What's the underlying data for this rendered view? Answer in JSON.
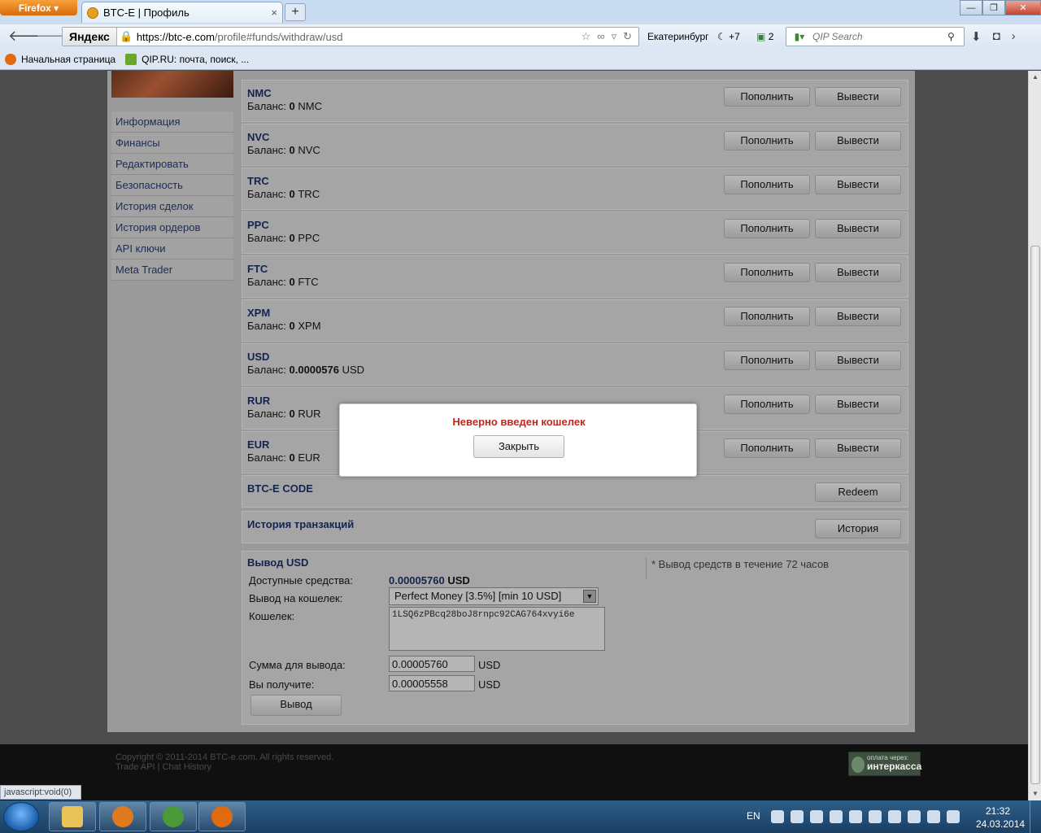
{
  "browser": {
    "menu_button": "Firefox",
    "tab_title": "BTC-E | Профиль",
    "tab_close": "×",
    "new_tab": "+",
    "url": {
      "scheme_host_prefix": "https://btc-e.com",
      "path": "/profile#funds/withdraw/usd"
    },
    "yandex_badge": "Яндекс",
    "weather_city": "Екатеринбург",
    "weather_temp": "+7",
    "mail_count": "2",
    "search_placeholder": "QIP Search",
    "window_buttons": [
      "—",
      "❐",
      "✕"
    ]
  },
  "bookmarks": [
    {
      "label": "Начальная страница"
    },
    {
      "label": "QIP.RU: почта, поиск, ..."
    }
  ],
  "sidebar": {
    "items": [
      "Информация",
      "Финансы",
      "Редактировать",
      "Безопасность",
      "История сделок",
      "История ордеров",
      "API ключи",
      "Meta Trader"
    ]
  },
  "balance_label": "Баланс:",
  "deposit_label": "Пополнить",
  "withdraw_label": "Вывести",
  "currencies": [
    {
      "code": "NMC",
      "amount": "0"
    },
    {
      "code": "NVC",
      "amount": "0"
    },
    {
      "code": "TRC",
      "amount": "0"
    },
    {
      "code": "PPC",
      "amount": "0"
    },
    {
      "code": "FTC",
      "amount": "0"
    },
    {
      "code": "XPM",
      "amount": "0"
    },
    {
      "code": "USD",
      "amount": "0.0000576"
    },
    {
      "code": "RUR",
      "amount": "0"
    },
    {
      "code": "EUR",
      "amount": "0"
    }
  ],
  "btce_code": {
    "title": "BTC-E CODE",
    "button": "Redeem"
  },
  "history": {
    "title": "История транзакций",
    "button": "История"
  },
  "withdraw": {
    "title": "Вывод USD",
    "note": "* Вывод средств в течение 72 часов",
    "available_label": "Доступные средства:",
    "available_value": "0.00005760",
    "available_currency": "USD",
    "method_label": "Вывод на кошелек:",
    "method_value": "Perfect Money [3.5%] [min 10 USD]",
    "wallet_label": "Кошелек:",
    "wallet_value": "1LSQ6zPBcq28boJ8rnpc92CAG764xvyi6e",
    "amount_label": "Сумма для вывода:",
    "amount_value": "0.00005760",
    "receive_label": "Вы получите:",
    "receive_value": "0.00005558",
    "unit": "USD",
    "submit": "Вывод"
  },
  "footer": {
    "copyright": "Copyright © 2011-2014 BTC-e.com. All rights reserved.",
    "links": "Trade API | Chat History",
    "interkassa_top": "оплата через:",
    "interkassa_name": "интеркасса"
  },
  "modal": {
    "message": "Неверно введен кошелек",
    "close": "Закрыть"
  },
  "status_text": "javascript:void(0)",
  "taskbar": {
    "lang": "EN",
    "time": "21:32",
    "date": "24.03.2014"
  }
}
